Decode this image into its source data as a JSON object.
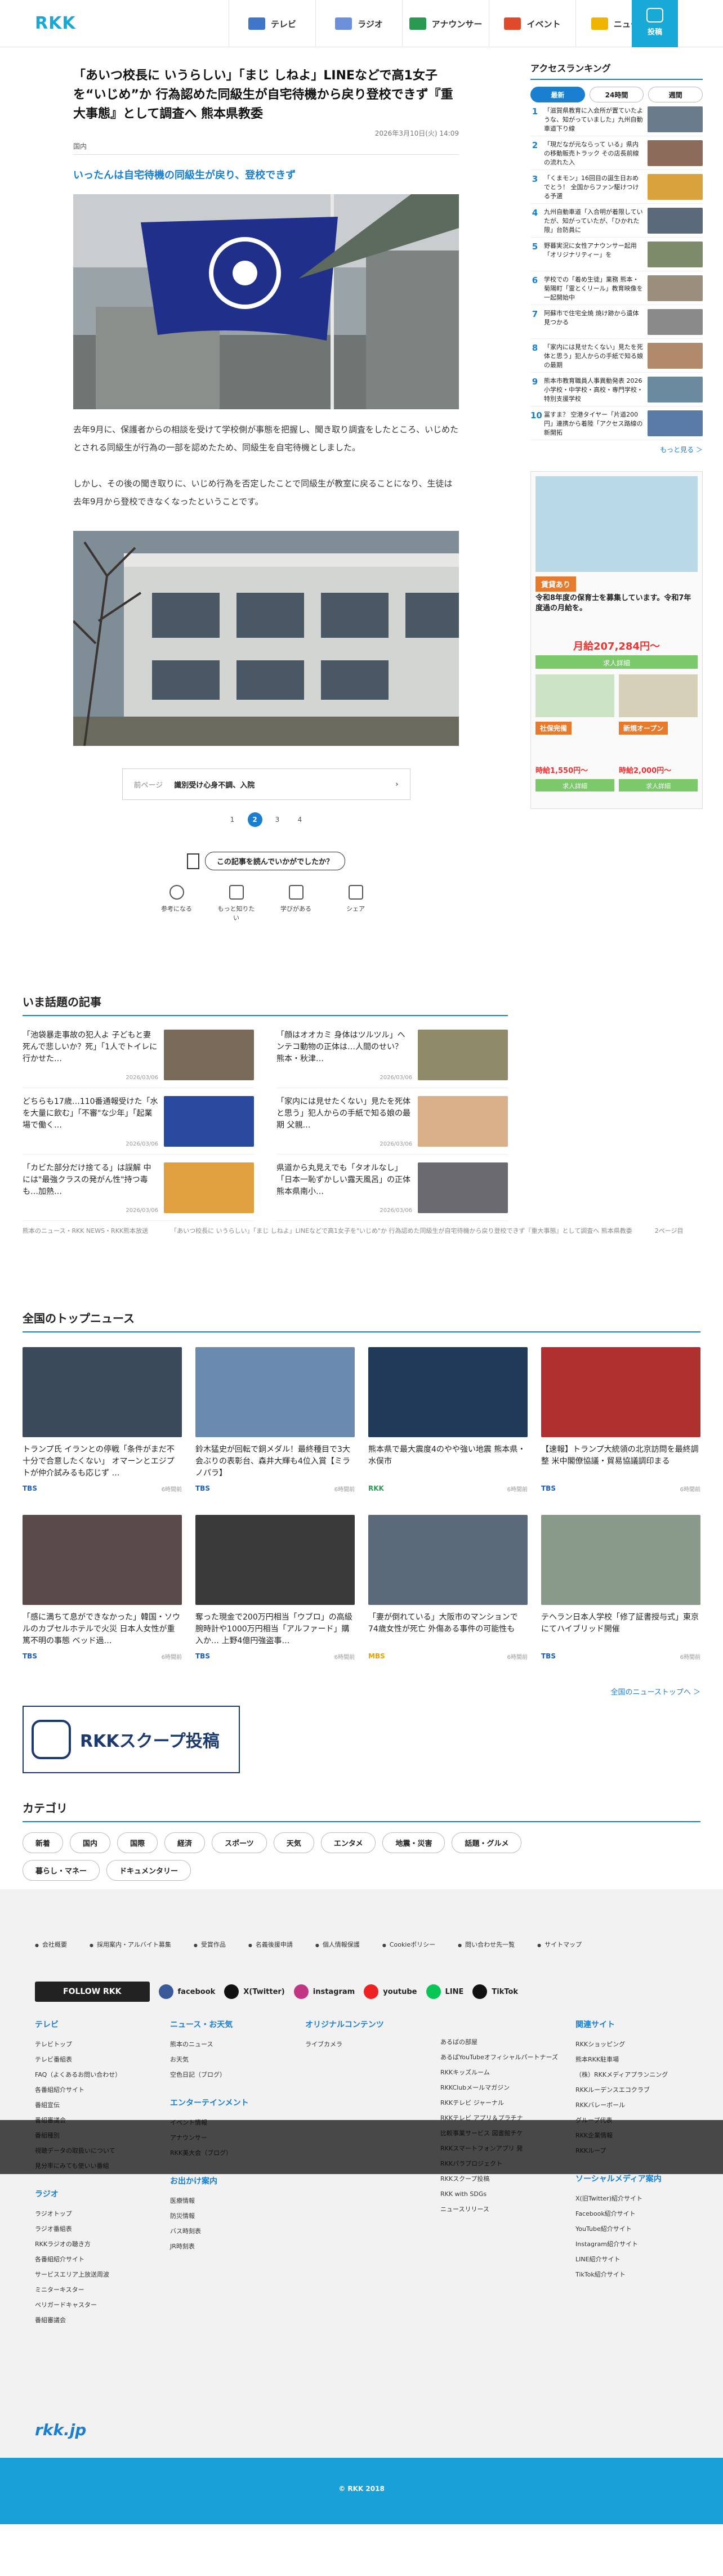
{
  "header": {
    "logo": "RKK",
    "nav": [
      {
        "label": "テレビ",
        "color": "#3f76c9"
      },
      {
        "label": "ラジオ",
        "color": "#6b8fd8"
      },
      {
        "label": "アナウンサー",
        "color": "#2a9a52"
      },
      {
        "label": "イベント",
        "color": "#e04a2a"
      },
      {
        "label": "ニュース",
        "color": "#f0b400"
      }
    ],
    "post": "投稿"
  },
  "article": {
    "title": "「あいつ校長に いうらしい」「まじ しねよ」LINEなどで高1女子を“いじめ”か 行為認めた同級生が自宅待機から戻り登校できず『重大事態』として調査へ 熊本県教委",
    "date": "2026年3月10日(火) 14:09",
    "category": "国内",
    "subtitle": "いったんは自宅待機の同級生が戻り、登校できず",
    "p1": "去年9月に、保護者からの相談を受けて学校側が事態を把握し、聞き取り調査をしたところ、いじめたとされる同級生が行為の一部を認めたため、同級生を自宅待機としました。",
    "p2": "しかし、その後の聞き取りに、いじめ行為を否定したことで同級生が教室に戻ることになり、生徒は去年9月から登校できなくなったということです。",
    "prev_label": "前ページ",
    "prev_title": "識別受け心身不調、入院",
    "pages": [
      "1",
      "2",
      "3",
      "4"
    ],
    "survey": "この記事を読んでいかがでしたか？",
    "reacts": [
      "参考になる",
      "もっと知りたい",
      "学びがある",
      "シェア"
    ]
  },
  "ranking": {
    "title": "アクセスランキング",
    "tabs": [
      "最新",
      "24時間",
      "週間"
    ],
    "items": [
      {
        "n": "1",
        "t": "「滋賀県教育に入会所が置ていたような、知がっていました」九州自動車道下り線"
      },
      {
        "n": "2",
        "t": "「現だなが元ならって いる」県内の移動販売トラック その店長前線の流れた入"
      },
      {
        "n": "3",
        "t": "「くまモン」16回目の誕生日おめでとう！ 全国からファン駆けつける予選"
      },
      {
        "n": "4",
        "t": "九州自動車道「入合明が着限していたが、知がっていたが、「ひかれた限」台防員に"
      },
      {
        "n": "5",
        "t": "野暮実況に女性アナウンサー起用 「オリジナリティー」を"
      },
      {
        "n": "6",
        "t": "学校での「着め生徒」業務 熊本・菊陽町「霊とくリール」教育映像を一起開始中"
      },
      {
        "n": "7",
        "t": "阿蘇市で住宅全焼 焼け跡から遺体見つかる"
      },
      {
        "n": "8",
        "t": "「家内には見せたくない」見たを死体と思う」犯人からの手紙で知る娘の最期"
      },
      {
        "n": "9",
        "t": "熊本市教育職員人事異動発表 2026 小学校・中学校・高校・専門学校・特別支援学校"
      },
      {
        "n": "10",
        "t": "冨すま？ 空港タイヤー「片道200円」連携から着陸「アクセス路線の新開拓"
      }
    ],
    "more": "もっと見る ＞"
  },
  "ad": {
    "h1": "賃貸あり",
    "t1": "令和8年度の保育士を募集しています。令和7年度過の月給を。",
    "price1": "月給207,284円〜",
    "btn": "求人詳細",
    "h2": "社保完備",
    "h3": "新規オープン",
    "p2": "時給1,550円〜",
    "p3": "時給2,000円〜"
  },
  "trending": {
    "title": "いま話題の記事",
    "items": [
      {
        "t": "「池袋暴走事故の犯人よ 子どもと妻死んで悲しいか？死」「1人でトイレに行かせた…",
        "d": "2026/03/06"
      },
      {
        "t": "「顔はオオカミ 身体はツルツル」ヘンテコ動物の正体は…人間のせい？ 熊本・秋津…",
        "d": "2026/03/06"
      },
      {
        "t": "どちらも17歳…110番通報受けた「水を大量に飲む」「不審\"な少年」「起業場で働く…",
        "d": "2026/03/06"
      },
      {
        "t": "「家内には見せたくない」見たを死体と思う」犯人からの手紙で知る娘の最期 父親…",
        "d": "2026/03/06"
      },
      {
        "t": "「カビた部分だけ捨てる」は誤解 中には\"最強クラスの発がん性\"持つ毒も…加熱…",
        "d": "2026/03/06"
      },
      {
        "t": "県道から丸見えでも「タオルなし」「日本一恥ずかしい露天風呂」の正体 熊本県南小…",
        "d": "2026/03/06"
      }
    ]
  },
  "breadcrumb": [
    "熊本のニュース・RKK NEWS・RKK熊本放送",
    "「あいつ校長に いうらしい」「まじ しねよ」LINEなどで高1女子を\"いじめ\"か 行為認めた同級生が自宅待機から戻り登校できず『重大事態』として調査へ 熊本県教委",
    "2ページ目"
  ],
  "topnews": {
    "title": "全国のトップニュース",
    "items": [
      {
        "t": "トランプ氏 イランとの停戦「条件がまだ不十分で合意したくない」 オマーンとエジプトが仲介試みるも応じず …",
        "s": "TBS",
        "d": "6時間前"
      },
      {
        "t": "鈴木猛史が回転で銅メダル！最終種目で3大会ぶりの表彰台、森井大輝も4位入賞【ミラノパラ】",
        "s": "TBS",
        "d": "6時間前"
      },
      {
        "t": "熊本県で最大震度4のやや強い地震 熊本県・水俣市",
        "s": "RKK",
        "d": "6時間前"
      },
      {
        "t": "【速報】トランプ大統領の北京訪問を最終調整 米中閣僚協議・貿易協議調印まる",
        "s": "TBS",
        "d": "6時間前"
      },
      {
        "t": "「感に満ちて息ができなかった」韓国・ソウルのカプセルホテルで火災 日本人女性が重篤不明の事態 ベッド過…",
        "s": "TBS",
        "d": "6時間前"
      },
      {
        "t": "奪った現金で200万円相当「ウブロ」の高級腕時計や1000万円相当「アルファード」購入か… 上野4億円強盗事…",
        "s": "TBS",
        "d": "6時間前"
      },
      {
        "t": "「妻が倒れている」大阪市のマンションで74歳女性が死亡 外傷ある事件の可能性も",
        "s": "MBS",
        "d": "6時間前"
      },
      {
        "t": "テヘラン日本人学校「修了証書授与式」東京にてハイブリッド開催",
        "s": "TBS",
        "d": "6時間前"
      }
    ],
    "more": "全国のニューストップへ ＞"
  },
  "scoop": "RKKスクープ投稿",
  "category": {
    "title": "カテゴリ",
    "items": [
      "新着",
      "国内",
      "国際",
      "経済",
      "スポーツ",
      "天気",
      "エンタメ",
      "地震・災害",
      "話題・グルメ",
      "暮らし・マネー",
      "ドキュメンタリー"
    ]
  },
  "footer": {
    "mini": [
      "会社概要",
      "採用案内・アルバイト募集",
      "受賞作品",
      "名義後援申請",
      "個人情報保護",
      "Cookieポリシー",
      "問い合わせ先一覧",
      "サイトマップ"
    ],
    "follow": "FOLLOW RKK",
    "social": [
      {
        "n": "facebook",
        "c": "#3a5998"
      },
      {
        "n": "X(Twitter)",
        "c": "#111"
      },
      {
        "n": "instagram",
        "c": "#c13584"
      },
      {
        "n": "youtube",
        "c": "#e22"
      },
      {
        "n": "LINE",
        "c": "#06c755"
      },
      {
        "n": "TikTok",
        "c": "#111"
      }
    ],
    "cols": [
      {
        "h": "テレビ",
        "l": [
          "テレビトップ",
          "テレビ番組表",
          "FAQ（よくあるお問い合わせ）",
          "各番組紹介サイト",
          "番組宣伝",
          "番組審議会",
          "番組種別",
          "視聴データの取扱いについて",
          "見分率にみても使いい番組"
        ],
        "h2": "ラジオ",
        "l2": [
          "ラジオトップ",
          "ラジオ番組表",
          "RKKラジオの聴き方",
          "各番組紹介サイト",
          "サービスエリア上放送周波",
          "ミニターキスター",
          "ベリガードキャスター",
          "番組審議会"
        ]
      },
      {
        "h": "ニュース・お天気",
        "l": [
          "熊本のニュース",
          "お天気",
          "空色日記（ブログ）"
        ],
        "h2": "エンターテインメント",
        "l2": [
          "イベント情報",
          "アナウンサー",
          "RKK美大会（ブログ）"
        ],
        "h3": "お出かけ案内",
        "l3": [
          "医療情報",
          "防災情報",
          "バス時刻表",
          "JR時刻表"
        ]
      },
      {
        "h": "オリジナルコンテンツ",
        "l": [
          "ライブカメラ"
        ]
      },
      {
        "h": "",
        "l": [
          "あるばの部屋",
          "あるばYouTubeオフィシャルパートナーズ",
          "RKKキッズルーム",
          "RKKClubメールマガジン",
          "RKKテレビ ジャーナル",
          "RKKテレビ アプリ＆プラチナ",
          "比較事業サービス 図書館チケ",
          "RKKスマートフォンアプリ 発",
          "RKKパラプロジェクト",
          "RKKスクープ投稿",
          "RKK with SDGs",
          "ニュースリリース"
        ]
      },
      {
        "h": "関連サイト",
        "l": [
          "RKKショッピング",
          "熊本RKK駐車場",
          "（株）RKKメディアプランニング",
          "RKKルーデンスエコクラブ",
          "RKKバレーボール",
          "グループ代表",
          "RKK企業情報",
          "RKKループ"
        ],
        "h2": "ソーシャルメディア案内",
        "l2": [
          "X(旧Twitter)紹介サイト",
          "Facebook紹介サイト",
          "YouTube紹介サイト",
          "Instagram紹介サイト",
          "LINE紹介サイト",
          "TikTok紹介サイト"
        ]
      }
    ]
  },
  "site": "rkk.jp",
  "copyright": "© RKK 2018"
}
